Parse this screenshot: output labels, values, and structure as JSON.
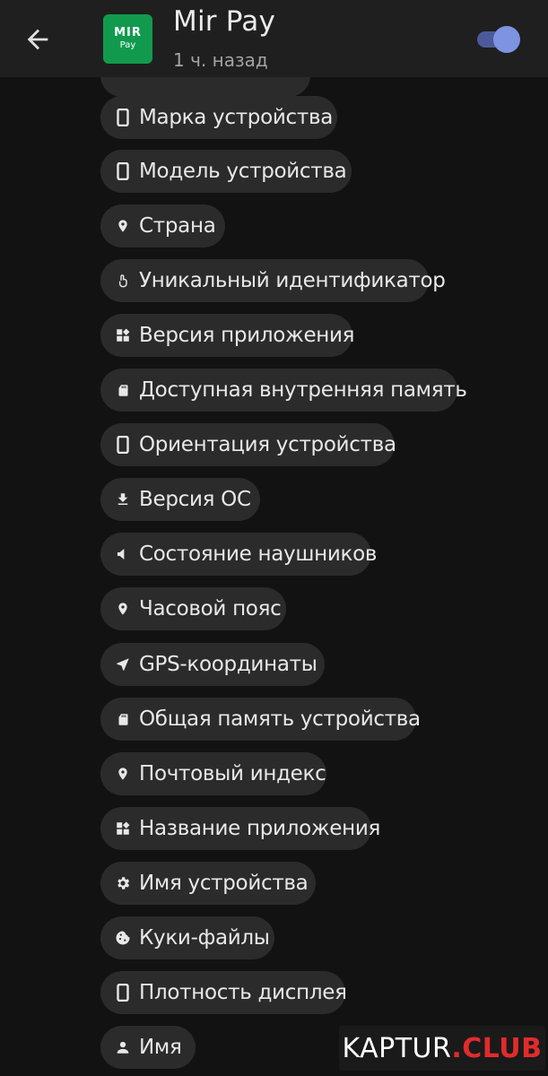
{
  "header": {
    "app_name": "Mir Pay",
    "time_ago": "1 ч. назад",
    "logo_top": "MIR",
    "logo_bottom": "Pay",
    "toggle_on": true,
    "back_icon": "arrow-left-icon"
  },
  "colors": {
    "background": "#121212",
    "header": "#1f1f1f",
    "chip": "#2b2b2b",
    "logo_green": "#119a4e",
    "toggle_thumb": "#7f93e3",
    "toggle_track": "#4d5a9a",
    "watermark_red": "#e22b2b"
  },
  "items": [
    {
      "label": "Марка устройства",
      "icon": "phone-icon"
    },
    {
      "label": "Модель устройства",
      "icon": "phone-icon"
    },
    {
      "label": "Страна",
      "icon": "location-pin-icon"
    },
    {
      "label": "Уникальный идентификатор",
      "icon": "fingerprint-icon"
    },
    {
      "label": "Версия приложения",
      "icon": "apps-icon"
    },
    {
      "label": "Доступная внутренняя память",
      "icon": "sd-card-icon"
    },
    {
      "label": "Ориентация устройства",
      "icon": "phone-icon"
    },
    {
      "label": "Версия ОС",
      "icon": "download-icon"
    },
    {
      "label": "Состояние наушников",
      "icon": "speaker-icon"
    },
    {
      "label": "Часовой пояс",
      "icon": "location-pin-icon"
    },
    {
      "label": "GPS-координаты",
      "icon": "navigation-arrow-icon"
    },
    {
      "label": "Общая память устройства",
      "icon": "sd-card-icon"
    },
    {
      "label": "Почтовый индекс",
      "icon": "location-pin-icon"
    },
    {
      "label": "Название приложения",
      "icon": "apps-icon"
    },
    {
      "label": "Имя устройства",
      "icon": "gear-icon"
    },
    {
      "label": "Куки-файлы",
      "icon": "cookie-icon"
    },
    {
      "label": "Плотность дисплея",
      "icon": "phone-icon"
    },
    {
      "label": "Имя",
      "icon": "person-icon"
    }
  ],
  "watermark": {
    "brand": "KAPTUR",
    "suffix": ".CLUB"
  }
}
